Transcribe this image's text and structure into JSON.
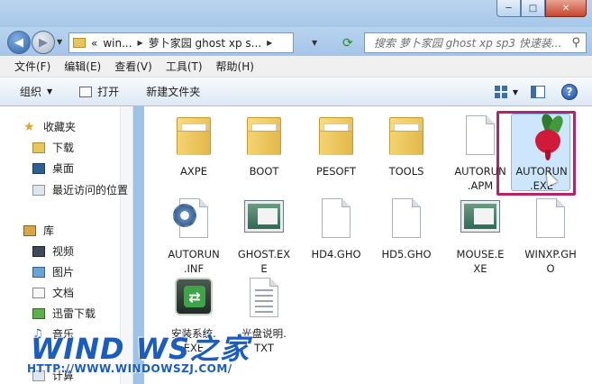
{
  "window": {
    "controls": {
      "minimize": "─",
      "maximize": "□",
      "close": "✕"
    }
  },
  "address_bar": {
    "segments": [
      "«",
      "win...",
      "萝卜家园 ghost xp s..."
    ],
    "search_placeholder": "搜索 萝卜家园 ghost xp sp3 快速装..."
  },
  "menu": [
    "文件(F)",
    "编辑(E)",
    "查看(V)",
    "工具(T)",
    "帮助(H)"
  ],
  "toolbar": {
    "organize": "组织",
    "open": "打开",
    "new_folder": "新建文件夹"
  },
  "nav_pane": {
    "favorites": "收藏夹",
    "downloads": "下载",
    "desktop": "桌面",
    "recent": "最近访问的位置",
    "libraries": "库",
    "video": "视频",
    "pictures": "图片",
    "documents": "文档",
    "xunlei": "迅雷下载",
    "music": "音乐",
    "more": "计算"
  },
  "files": [
    {
      "name": "AXPE",
      "type": "folder"
    },
    {
      "name": "BOOT",
      "type": "folder"
    },
    {
      "name": "PESOFT",
      "type": "folder"
    },
    {
      "name": "TOOLS",
      "type": "folder"
    },
    {
      "name": "AUTORUN\n.APM",
      "type": "file"
    },
    {
      "name": "AUTORUN\n.EXE",
      "type": "radish",
      "selected": true
    },
    {
      "name": "AUTORUN\n.INF",
      "type": "config"
    },
    {
      "name": "GHOST.EX\nE",
      "type": "exe"
    },
    {
      "name": "HD4.GHO",
      "type": "file"
    },
    {
      "name": "HD5.GHO",
      "type": "file"
    },
    {
      "name": "MOUSE.E\nXE",
      "type": "exe"
    },
    {
      "name": "WINXP.GH\nO",
      "type": "file"
    },
    {
      "name": "安装系统.\nEXE",
      "type": "setup"
    },
    {
      "name": "光盘说明.\nTXT",
      "type": "txt"
    }
  ],
  "watermark": {
    "brand": "WIND WS之家",
    "url": "HTTP://WWW.WINDOWSZJ.COM/"
  },
  "colors": {
    "selection_highlight": "#b4246a",
    "selection_fill": "#cde6fb",
    "chrome": "#a7c7e9"
  }
}
